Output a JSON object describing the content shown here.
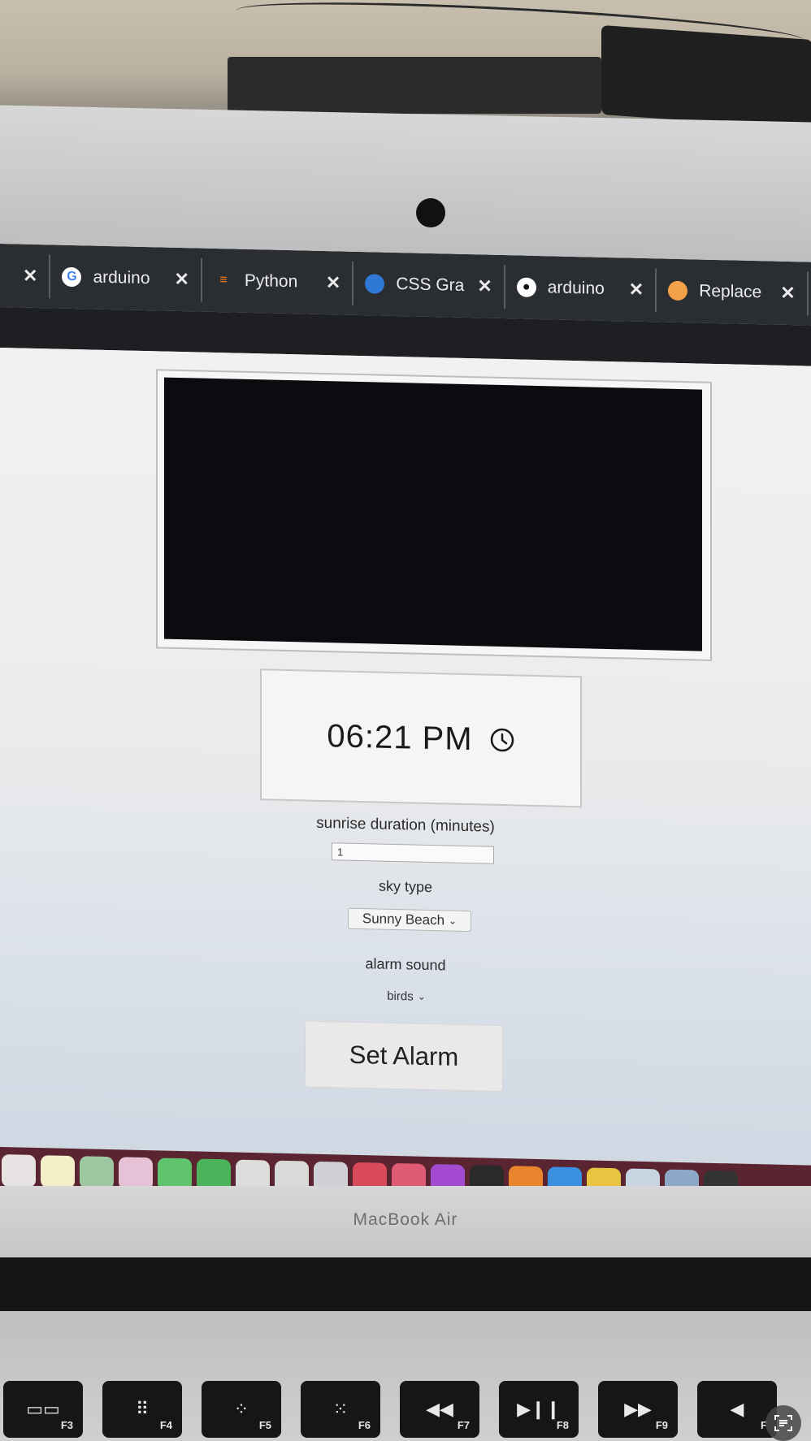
{
  "browser": {
    "tabs": [
      {
        "label": "",
        "icon": "close-icon",
        "close": "✕"
      },
      {
        "label": "arduino",
        "icon": "google-icon",
        "close": "✕"
      },
      {
        "label": "Python",
        "icon": "stackoverflow-icon",
        "close": "✕"
      },
      {
        "label": "CSS Gra",
        "icon": "css-icon",
        "close": "✕"
      },
      {
        "label": "arduino",
        "icon": "github-icon",
        "close": "✕"
      },
      {
        "label": "Replace",
        "icon": "orange-dot-icon",
        "close": "✕"
      }
    ]
  },
  "alarm": {
    "time": "06:21 PM",
    "duration_label": "sunrise duration (minutes)",
    "duration_value": "1",
    "sky_label": "sky type",
    "sky_value": "Sunny Beach",
    "sound_label": "alarm sound",
    "sound_value": "birds",
    "set_button": "Set Alarm"
  },
  "laptop": {
    "brand": "MacBook Air",
    "function_keys": [
      "F3",
      "F4",
      "F5",
      "F6",
      "F7",
      "F8",
      "F9",
      "F"
    ]
  },
  "colors": {
    "tabbar": "#2a2d31",
    "dock": "#5a2430",
    "video": "#0c0c10"
  }
}
